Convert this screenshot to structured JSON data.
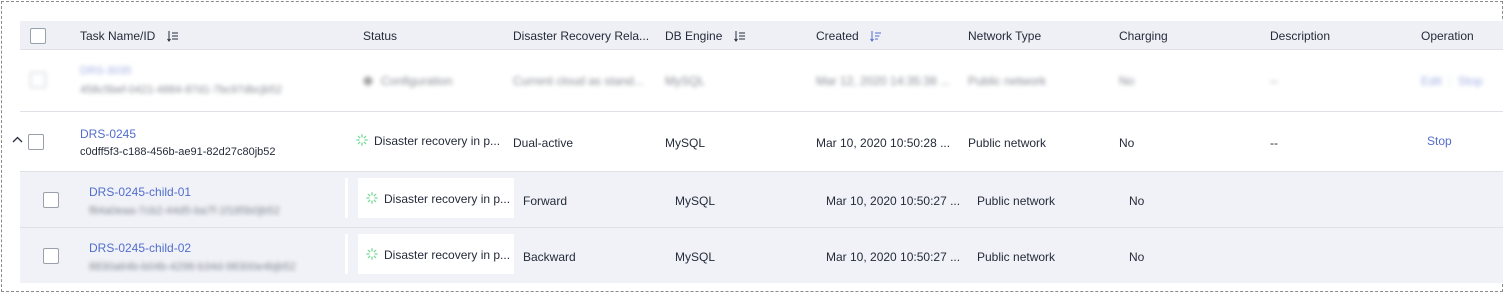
{
  "header": {
    "task_name": "Task Name/ID",
    "status": "Status",
    "dr_relation": "Disaster Recovery Rela...",
    "db_engine": "DB Engine",
    "created": "Created",
    "network_type": "Network Type",
    "charging": "Charging",
    "description": "Description",
    "operation": "Operation"
  },
  "rows": [
    {
      "name": "DRS-3035",
      "id": "458c5bef-0421-4884-87d1-7bc97dbcjb52",
      "status": "Configuration",
      "relation": "Current cloud as stand...",
      "engine": "MySQL",
      "created": "Mar 12, 2020 14:35:38 ...",
      "network": "Public network",
      "charging": "No",
      "description": "--",
      "op_edit": "Edit",
      "op_stop": "Stop"
    },
    {
      "name": "DRS-0245",
      "id": "c0dff5f3-c188-456b-ae91-82d27c80jb52",
      "status": "Disaster recovery in p...",
      "relation": "Dual-active",
      "engine": "MySQL",
      "created": "Mar 10, 2020 10:50:28 ...",
      "network": "Public network",
      "charging": "No",
      "description": "--",
      "op_stop": "Stop"
    },
    {
      "name": "DRS-0245-child-01",
      "id": "f84a0eaa-7cb2-44d5-ba7f-1f185b0jb52",
      "status": "Disaster recovery in p...",
      "relation": "Forward",
      "engine": "MySQL",
      "created": "Mar 10, 2020 10:50:27 ...",
      "network": "Public network",
      "charging": "No"
    },
    {
      "name": "DRS-0245-child-02",
      "id": "8830a64b-b04b-4298-b34d-98300e4bjb52",
      "status": "Disaster recovery in p...",
      "relation": "Backward",
      "engine": "MySQL",
      "created": "Mar 10, 2020 10:50:27 ...",
      "network": "Public network",
      "charging": "No"
    }
  ],
  "icons": {
    "sort": "sort-icon",
    "sort_active": "sort-desc-icon",
    "expand": "chevron-up-icon",
    "status_config": "dot-icon",
    "status_sync": "spinner-icon"
  },
  "colors": {
    "link": "#526ecc",
    "header_bg": "#eef0f5",
    "child_bg": "#f0f2f7",
    "spinner": "#7ed99c"
  }
}
